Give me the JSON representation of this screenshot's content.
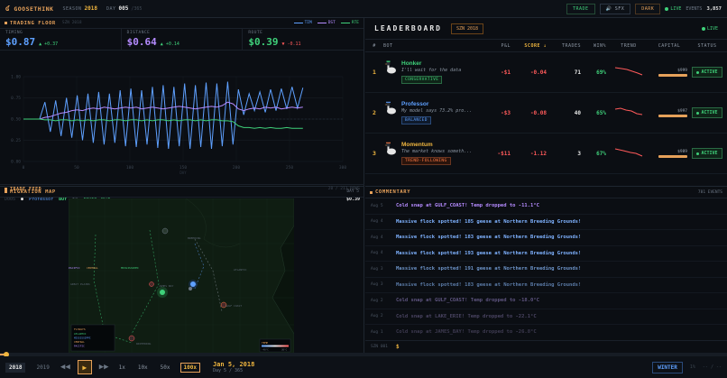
{
  "topbar": {
    "brand": "GOOSETHINK",
    "season_label": "SEASON",
    "season_value": "2018",
    "day_label": "DAY",
    "day_value": "005",
    "day_total": "/365",
    "trade_btn": "TRADE",
    "sfx_btn": "SFX",
    "dark_btn": "DARK",
    "live": "LIVE",
    "events_label": "EVENTS",
    "events_value": "3,857"
  },
  "trading": {
    "title": "TRADING FLOOR",
    "subtitle": "SZN 2018",
    "legend": [
      {
        "name": "TIM",
        "color": "#5ea0ff"
      },
      {
        "name": "DST",
        "color": "#b58bff"
      },
      {
        "name": "RTE",
        "color": "#3fd17a"
      }
    ],
    "metrics": [
      {
        "label": "TIMING",
        "value": "$0.87",
        "delta": "▲ +0.37",
        "color": "#5ea0ff",
        "delta_color": "#3fd17a"
      },
      {
        "label": "DISTANCE",
        "value": "$0.64",
        "delta": "▲ +0.14",
        "color": "#b58bff",
        "delta_color": "#3fd17a"
      },
      {
        "label": "ROUTE",
        "value": "$0.39",
        "delta": "▼ -0.11",
        "color": "#3fd17a",
        "delta_color": "#ff5a5a"
      }
    ],
    "y_ticks": [
      "1.00",
      "0.75",
      "0.50",
      "0.25",
      "0.00"
    ],
    "x_ticks": [
      "0",
      "50",
      "100",
      "150",
      "200",
      "250",
      "300"
    ],
    "x_label": "DAY",
    "feed_title": "TRADE FEED",
    "feed_right": "20 / 211 ROWS",
    "feed_row": {
      "day": "D005",
      "bot": "Professor",
      "side": "BUY",
      "qty": "5×",
      "contract": "route_2018",
      "price": "$0.39"
    }
  },
  "chart_data": {
    "type": "line",
    "ylim": [
      0,
      1
    ],
    "xlim": [
      0,
      300
    ],
    "series": [
      {
        "name": "TIM",
        "color": "#5ea0ff",
        "values": [
          0.5,
          0.5,
          0.5,
          0.5,
          0.7,
          0.35,
          0.72,
          0.3,
          0.75,
          0.28,
          0.78,
          0.25,
          0.8,
          0.22,
          0.82,
          0.2,
          0.8,
          0.22,
          0.84,
          0.18,
          0.86,
          0.17,
          0.84,
          0.2,
          0.88,
          0.16,
          0.9,
          0.15,
          0.88,
          0.18,
          0.92,
          0.15,
          0.9,
          0.17,
          0.93,
          0.15,
          0.92,
          0.18,
          0.94,
          0.2,
          0.85,
          0.55,
          0.8,
          0.6,
          0.82,
          0.58,
          0.85,
          0.6,
          0.86,
          0.62,
          0.88,
          0.63,
          0.87
        ]
      },
      {
        "name": "DST",
        "color": "#b58bff",
        "values": [
          0.5,
          0.5,
          0.5,
          0.5,
          0.52,
          0.53,
          0.55,
          0.57,
          0.58,
          0.6,
          0.61,
          0.6,
          0.62,
          0.63,
          0.62,
          0.64,
          0.63,
          0.62,
          0.63,
          0.64,
          0.63,
          0.64,
          0.62,
          0.63,
          0.64,
          0.63,
          0.62,
          0.63,
          0.64,
          0.65,
          0.64,
          0.63,
          0.62,
          0.63,
          0.64,
          0.65,
          0.64,
          0.66,
          0.7,
          0.68,
          0.62,
          0.6,
          0.62,
          0.63,
          0.62,
          0.64,
          0.63,
          0.64,
          0.62,
          0.63,
          0.64,
          0.63,
          0.64
        ]
      },
      {
        "name": "RTE",
        "color": "#3fd17a",
        "values": [
          0.5,
          0.5,
          0.5,
          0.5,
          0.49,
          0.49,
          0.48,
          0.49,
          0.49,
          0.48,
          0.49,
          0.48,
          0.49,
          0.48,
          0.49,
          0.49,
          0.48,
          0.49,
          0.49,
          0.48,
          0.49,
          0.49,
          0.48,
          0.49,
          0.48,
          0.49,
          0.49,
          0.48,
          0.49,
          0.48,
          0.49,
          0.49,
          0.48,
          0.49,
          0.48,
          0.49,
          0.49,
          0.48,
          0.48,
          0.47,
          0.42,
          0.4,
          0.4,
          0.39,
          0.4,
          0.39,
          0.4,
          0.39,
          0.39,
          0.4,
          0.39,
          0.39,
          0.39
        ]
      }
    ]
  },
  "migration": {
    "title": "MIGRATION MAP",
    "right": "DAY 5",
    "labels": [
      "BREEDING",
      "ATLANTIC",
      "CENTRAL",
      "MISSISSIPPI",
      "PACIFIC",
      "GULF COAST",
      "WINTERING",
      "JAMES BAY",
      "GREAT PLAINS"
    ],
    "flyways_title": "FLYWAYS",
    "flyways": [
      "ATLANTIC",
      "MISSISSIPPI",
      "CENTRAL",
      "PACIFIC"
    ],
    "temp_title": "TEMP",
    "temp_lo": "-40°C",
    "temp_hi": "30°C"
  },
  "leaderboard": {
    "title": "LEADERBOARD",
    "season": "SZN 2018",
    "live": "LIVE",
    "cols": [
      "#",
      "BOT",
      "P&L",
      "SCORE ↓",
      "TRADES",
      "WIN%",
      "TREND",
      "CAPITAL",
      "STATUS"
    ],
    "rows": [
      {
        "rank": "1",
        "name": "Honker",
        "name_color": "#f0b63f",
        "quote": "I'll wait for the data",
        "tag": "CONSERVATIVE",
        "tag_color": "#3fd17a",
        "pl": "-$1",
        "score": "-0.04",
        "trades": "71",
        "wins": "69%",
        "capital": "$999",
        "status": "ACTIVE"
      },
      {
        "rank": "2",
        "name": "Professor",
        "name_color": "#5ea0ff",
        "quote": "My model says 73.2% pro...",
        "tag": "BALANCED",
        "tag_color": "#5ea0ff",
        "pl": "-$3",
        "score": "-0.08",
        "trades": "40",
        "wins": "65%",
        "capital": "$997",
        "status": "ACTIVE"
      },
      {
        "rank": "3",
        "name": "Momentum",
        "name_color": "#f0b63f",
        "quote": "The market knows someth...",
        "tag": "TREND-FOLLOWING",
        "tag_color": "#ff7a45",
        "pl": "-$11",
        "score": "-1.12",
        "trades": "3",
        "wins": "67%",
        "capital": "$989",
        "status": "ACTIVE"
      }
    ]
  },
  "commentary": {
    "title": "COMMENTARY",
    "right": "781 EVENTS",
    "rows": [
      {
        "day": "Aug 5",
        "text": "Cold snap at GULF_COAST! Temp dropped to -11.1°C",
        "color": "#b58bff"
      },
      {
        "day": "Aug 4",
        "text": "Massive flock spotted! 185 geese at Northern Breeding Grounds!",
        "color": "#7fb2ff"
      },
      {
        "day": "Aug 4",
        "text": "Massive flock spotted! 183 geese at Northern Breeding Grounds!",
        "color": "#7fb2ff"
      },
      {
        "day": "Aug 4",
        "text": "Massive flock spotted! 193 geese at Northern Breeding Grounds!",
        "color": "#7fb2ff"
      },
      {
        "day": "Aug 3",
        "text": "Massive flock spotted! 191 geese at Northern Breeding Grounds!",
        "color": "#6c93c8"
      },
      {
        "day": "Aug 3",
        "text": "Massive flock spotted! 183 geese at Northern Breeding Grounds!",
        "color": "#5a7aa6"
      },
      {
        "day": "Aug 2",
        "text": "Cold snap at GULF_COAST! Temp dropped to -18.0°C",
        "color": "#5f5580"
      },
      {
        "day": "Aug 2",
        "text": "Cold snap at LAKE_ERIE! Temp dropped to -22.1°C",
        "color": "#4a4462"
      },
      {
        "day": "Aug 1",
        "text": "Cold snap at JAMES_BAY! Temp dropped to -26.8°C",
        "color": "#3d3a50"
      }
    ],
    "input_day": "SZN 001",
    "input_value": "$"
  },
  "bottom": {
    "years": [
      "2018",
      "2019"
    ],
    "speeds": [
      "1x",
      "10x",
      "50x",
      "100x"
    ],
    "date": "Jan 5, 2018",
    "day": "Day 5 / 365",
    "season": "WINTER",
    "dim1": "1%",
    "dim2": "-- / --"
  }
}
